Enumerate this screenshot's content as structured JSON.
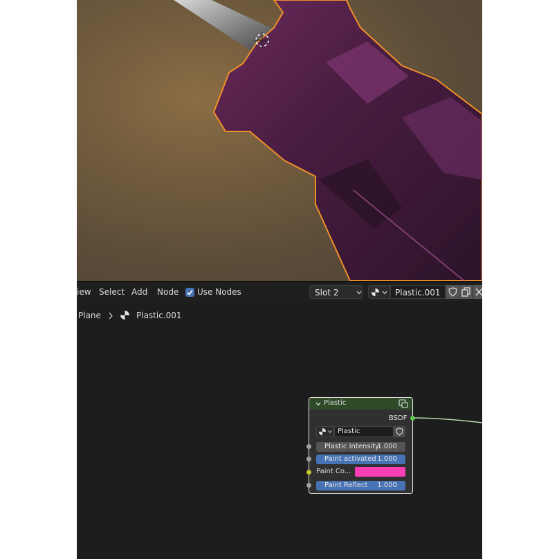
{
  "header": {
    "menu": [
      "iew",
      "Select",
      "Add",
      "Node"
    ],
    "use_nodes_label": "Use Nodes",
    "use_nodes_checked": true,
    "slot": "Slot 2",
    "material_name": "Plastic.001"
  },
  "breadcrumb": {
    "object": "Plane",
    "material": "Plastic.001"
  },
  "node": {
    "title": "Plastic",
    "output": "BSDF",
    "group_name": "Plastic",
    "inputs": [
      {
        "label": "Plastic Intensity",
        "value": "1.000"
      },
      {
        "label": "Paint activated",
        "value": "1.000"
      },
      {
        "label": "Paint Co...",
        "color": "#ff3fb5"
      },
      {
        "label": "Paint Reflect",
        "value": "1.000"
      }
    ]
  },
  "colors": {
    "accent": "#4772b3",
    "node_header": "#2e4a27",
    "paint_color": "#ff3fb5",
    "selection_outline": "#f0902a"
  }
}
